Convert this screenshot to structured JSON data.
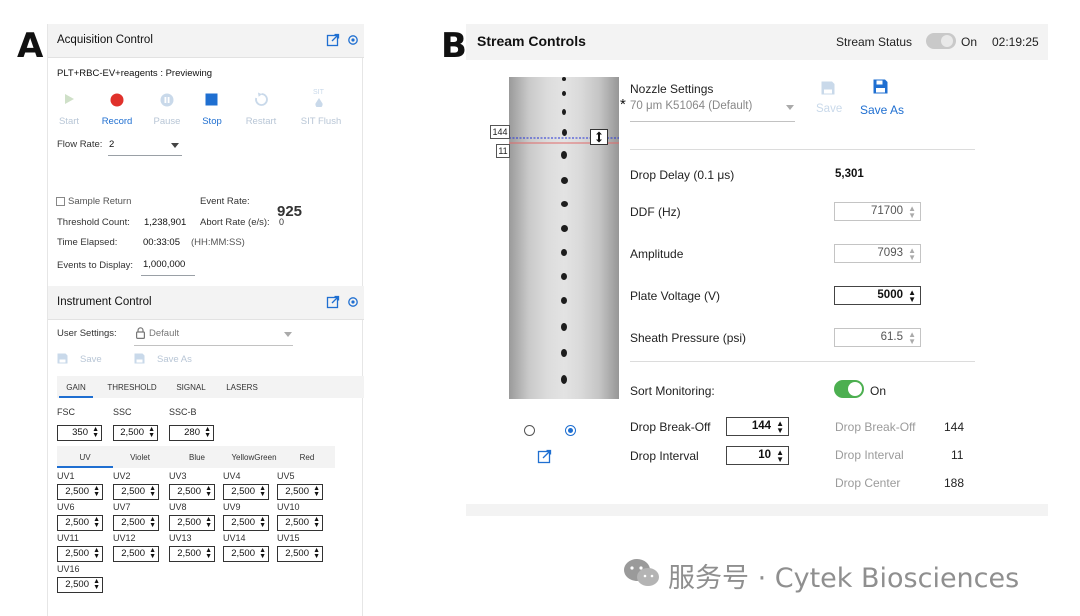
{
  "labels": {
    "panel_a": "A",
    "panel_b": "B"
  },
  "acquisition": {
    "title": "Acquisition Control",
    "experiment": "PLT+RBC-EV+reagents : Previewing",
    "toolbar": [
      {
        "label": "Start",
        "icon": "play-icon",
        "state": "disabled"
      },
      {
        "label": "Record",
        "icon": "record-icon",
        "state": "active"
      },
      {
        "label": "Pause",
        "icon": "pause-icon",
        "state": "disabled"
      },
      {
        "label": "Stop",
        "icon": "stop-icon",
        "state": "active"
      },
      {
        "label": "Restart",
        "icon": "restart-icon",
        "state": "disabled"
      },
      {
        "label": "SIT Flush",
        "icon": "sit-flush-icon",
        "state": "disabled"
      }
    ],
    "sit_icon_text": "SIT",
    "flow_rate_label": "Flow Rate:",
    "flow_rate_value": "2",
    "sample_return_label": "Sample Return",
    "event_rate_label": "Event Rate:",
    "event_rate_value": "925",
    "threshold_count_label": "Threshold Count:",
    "threshold_count_value": "1,238,901",
    "abort_rate_label": "Abort Rate (e/s):",
    "abort_rate_value": "0",
    "time_elapsed_label": "Time Elapsed:",
    "time_elapsed_value": "00:33:05",
    "time_format": "(HH:MM:SS)",
    "events_to_display_label": "Events to Display:",
    "events_to_display_value": "1,000,000"
  },
  "instrument": {
    "title": "Instrument Control",
    "user_settings_label": "User Settings:",
    "user_settings_value": "Default",
    "save_label": "Save",
    "save_as_label": "Save As",
    "tabs": [
      "GAIN",
      "THRESHOLD",
      "SIGNAL",
      "LASERS"
    ],
    "active_tab": "GAIN",
    "scatter": [
      {
        "name": "FSC",
        "value": "350"
      },
      {
        "name": "SSC",
        "value": "2,500"
      },
      {
        "name": "SSC-B",
        "value": "280"
      }
    ],
    "laser_tabs": [
      "UV",
      "Violet",
      "Blue",
      "YellowGreen",
      "Red"
    ],
    "active_laser_tab": "UV",
    "detectors": [
      {
        "name": "UV1",
        "value": "2,500"
      },
      {
        "name": "UV2",
        "value": "2,500"
      },
      {
        "name": "UV3",
        "value": "2,500"
      },
      {
        "name": "UV4",
        "value": "2,500"
      },
      {
        "name": "UV5",
        "value": "2,500"
      },
      {
        "name": "UV6",
        "value": "2,500"
      },
      {
        "name": "UV7",
        "value": "2,500"
      },
      {
        "name": "UV8",
        "value": "2,500"
      },
      {
        "name": "UV9",
        "value": "2,500"
      },
      {
        "name": "UV10",
        "value": "2,500"
      },
      {
        "name": "UV11",
        "value": "2,500"
      },
      {
        "name": "UV12",
        "value": "2,500"
      },
      {
        "name": "UV13",
        "value": "2,500"
      },
      {
        "name": "UV14",
        "value": "2,500"
      },
      {
        "name": "UV15",
        "value": "2,500"
      },
      {
        "name": "UV16",
        "value": "2,500"
      }
    ]
  },
  "stream": {
    "title": "Stream Controls",
    "status_label": "Stream Status",
    "status_value": "On",
    "time": "02:19:25",
    "marker_top": "144",
    "marker_bottom": "11",
    "nozzle_label": "Nozzle Settings",
    "nozzle_marker": "*",
    "nozzle_value": "70 μm K51064 (Default)",
    "save_label": "Save",
    "save_as_label": "Save As",
    "drop_delay_label": "Drop Delay (0.1 μs)",
    "drop_delay_value": "5,301",
    "ddf_label": "DDF (Hz)",
    "ddf_value": "71700",
    "amplitude_label": "Amplitude",
    "amplitude_value": "7093",
    "plate_voltage_label": "Plate Voltage (V)",
    "plate_voltage_value": "5000",
    "sheath_pressure_label": "Sheath Pressure (psi)",
    "sheath_pressure_value": "61.5",
    "sort_monitoring_label": "Sort Monitoring:",
    "sort_monitoring_value": "On",
    "drop_breakoff_label": "Drop Break-Off",
    "drop_breakoff_value": "144",
    "drop_interval_label": "Drop Interval",
    "drop_interval_value": "10",
    "readout_breakoff_label": "Drop Break-Off",
    "readout_breakoff_value": "144",
    "readout_interval_label": "Drop Interval",
    "readout_interval_value": "11",
    "readout_center_label": "Drop Center",
    "readout_center_value": "188"
  },
  "watermark": "服务号 · Cytek Biosciences",
  "colors": {
    "accent": "#1f6fd1",
    "record": "#e0312b",
    "toggle_on": "#4caf50",
    "disabled": "#b8c6d6"
  }
}
